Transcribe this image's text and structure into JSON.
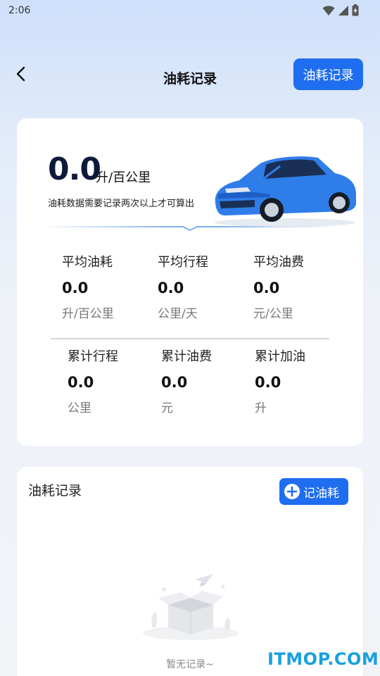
{
  "status_bar": {
    "time": "2:06"
  },
  "header": {
    "title": "油耗记录",
    "action_label": "油耗记录"
  },
  "summary": {
    "value": "0.0",
    "unit": "升/百公里",
    "hint": "油耗数据需要记录两次以上才可算出"
  },
  "stats_top": [
    {
      "label": "平均油耗",
      "value": "0.0",
      "unit": "升/百公里"
    },
    {
      "label": "平均行程",
      "value": "0.0",
      "unit": "公里/天"
    },
    {
      "label": "平均油费",
      "value": "0.0",
      "unit": "元/公里"
    }
  ],
  "stats_bottom": [
    {
      "label": "累计行程",
      "value": "0.0",
      "unit": "公里"
    },
    {
      "label": "累计油费",
      "value": "0.0",
      "unit": "元"
    },
    {
      "label": "累计加油",
      "value": "0.0",
      "unit": "升"
    }
  ],
  "records": {
    "title": "油耗记录",
    "add_label": "记油耗",
    "empty_text": "暂无记录~"
  },
  "watermark": "ITMOP.COM",
  "colors": {
    "accent": "#1f6ef0",
    "car_body": "#2f7de8",
    "watermark": "#1aa0e0"
  }
}
